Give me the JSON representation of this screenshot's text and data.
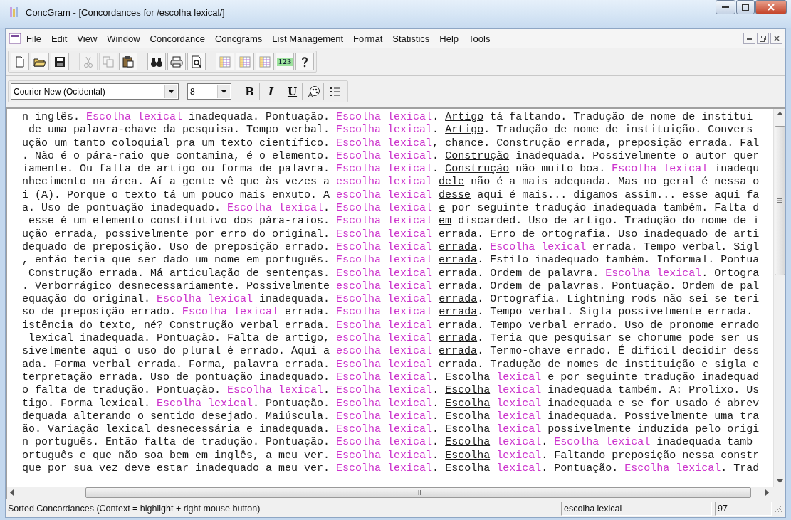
{
  "window": {
    "title": "ConcGram - [Concordances for /escolha lexical/]"
  },
  "menu": [
    {
      "label": "File"
    },
    {
      "label": "Edit"
    },
    {
      "label": "View"
    },
    {
      "label": "Window"
    },
    {
      "label": "Concordance"
    },
    {
      "label": "Concgrams"
    },
    {
      "label": "List Management"
    },
    {
      "label": "Format"
    },
    {
      "label": "Statistics"
    },
    {
      "label": "Help"
    },
    {
      "label": "Tools"
    }
  ],
  "toolbar": [
    {
      "kind": "new"
    },
    {
      "kind": "open"
    },
    {
      "kind": "save"
    },
    {
      "kind": "sep"
    },
    {
      "kind": "cut",
      "disabled": true
    },
    {
      "kind": "copy",
      "disabled": true
    },
    {
      "kind": "paste"
    },
    {
      "kind": "sep"
    },
    {
      "kind": "find"
    },
    {
      "kind": "print"
    },
    {
      "kind": "preview"
    },
    {
      "kind": "sep"
    },
    {
      "kind": "grid"
    },
    {
      "kind": "grid"
    },
    {
      "kind": "grid"
    },
    {
      "kind": "number",
      "label": "123"
    },
    {
      "kind": "help"
    }
  ],
  "format_bar": {
    "font": "Courier New (Ocidental)",
    "size": "8",
    "buttons": [
      {
        "kind": "bold",
        "label": "B"
      },
      {
        "kind": "italic",
        "label": "I"
      },
      {
        "kind": "underline",
        "label": "U"
      },
      {
        "kind": "color"
      },
      {
        "kind": "list"
      }
    ]
  },
  "concordance": {
    "lines": [
      {
        "segments": [
          {
            "kind": "text",
            "text": "n inglês. "
          },
          {
            "kind": "keyword",
            "text": "Escolha lexical"
          },
          {
            "kind": "text",
            "text": " inadequada. Pontuação. "
          },
          {
            "kind": "keyword",
            "text": "Escolha lexical"
          },
          {
            "kind": "text",
            "text": ". "
          },
          {
            "kind": "collocate",
            "text": "Artigo"
          },
          {
            "kind": "text",
            "text": " tá faltando. Tradução de nome de institui"
          }
        ]
      },
      {
        "segments": [
          {
            "kind": "text",
            "text": " de uma palavra-chave da pesquisa. Tempo verbal. "
          },
          {
            "kind": "keyword",
            "text": "Escolha lexical"
          },
          {
            "kind": "text",
            "text": ". "
          },
          {
            "kind": "collocate",
            "text": "Artigo"
          },
          {
            "kind": "text",
            "text": ". Tradução de nome de instituição. Convers"
          }
        ]
      },
      {
        "segments": [
          {
            "kind": "text",
            "text": "ução um tanto coloquial pra um texto científico. "
          },
          {
            "kind": "keyword",
            "text": "Escolha lexical"
          },
          {
            "kind": "text",
            "text": ", "
          },
          {
            "kind": "collocate",
            "text": "chance"
          },
          {
            "kind": "text",
            "text": ". Construção errada, preposição errada. Fal"
          }
        ]
      },
      {
        "segments": [
          {
            "kind": "text",
            "text": ". Não é o pára-raio que contamina, é o elemento. "
          },
          {
            "kind": "keyword",
            "text": "Escolha lexical"
          },
          {
            "kind": "text",
            "text": ". "
          },
          {
            "kind": "collocate",
            "text": "Construção"
          },
          {
            "kind": "text",
            "text": " inadequada. Possivelmente o autor quer"
          }
        ]
      },
      {
        "segments": [
          {
            "kind": "text",
            "text": "iamente. Ou falta de artigo ou forma de palavra. "
          },
          {
            "kind": "keyword",
            "text": "Escolha lexical"
          },
          {
            "kind": "text",
            "text": ". "
          },
          {
            "kind": "collocate",
            "text": "Construção"
          },
          {
            "kind": "text",
            "text": " não muito boa. "
          },
          {
            "kind": "keyword",
            "text": "Escolha lexical"
          },
          {
            "kind": "text",
            "text": " inadequ"
          }
        ]
      },
      {
        "segments": [
          {
            "kind": "text",
            "text": "nhecimento na área. Aí a gente vê que às vezes a "
          },
          {
            "kind": "keyword",
            "text": "escolha lexical "
          },
          {
            "kind": "collocate",
            "text": "dele"
          },
          {
            "kind": "text",
            "text": " não é a mais adequada. Mas no geral é nessa o"
          }
        ]
      },
      {
        "segments": [
          {
            "kind": "text",
            "text": "i (A). Porque o texto tá um pouco mais enxuto. A "
          },
          {
            "kind": "keyword",
            "text": "escolha lexical "
          },
          {
            "kind": "collocate",
            "text": "desse"
          },
          {
            "kind": "text",
            "text": " aqui é mais... digamos assim... esse aqui fa"
          }
        ]
      },
      {
        "segments": [
          {
            "kind": "text",
            "text": "a. Uso de pontuação inadequado. "
          },
          {
            "kind": "keyword",
            "text": "Escolha lexical"
          },
          {
            "kind": "text",
            "text": ". "
          },
          {
            "kind": "keyword",
            "text": "Escolha lexical "
          },
          {
            "kind": "collocate",
            "text": "e"
          },
          {
            "kind": "text",
            "text": " por seguinte tradução inadequada também. Falta d"
          }
        ]
      },
      {
        "segments": [
          {
            "kind": "text",
            "text": " esse é um elemento constitutivo dos pára-raios. "
          },
          {
            "kind": "keyword",
            "text": "Escolha lexical "
          },
          {
            "kind": "collocate",
            "text": "em"
          },
          {
            "kind": "text",
            "text": " discarded. Uso de artigo. Tradução do nome de i"
          }
        ]
      },
      {
        "segments": [
          {
            "kind": "text",
            "text": "ução errada, possivelmente por erro do original. "
          },
          {
            "kind": "keyword",
            "text": "Escolha lexical "
          },
          {
            "kind": "collocate",
            "text": "errada"
          },
          {
            "kind": "text",
            "text": ". Erro de ortografia. Uso inadequado de arti"
          }
        ]
      },
      {
        "segments": [
          {
            "kind": "text",
            "text": "dequado de preposição. Uso de preposição errado. "
          },
          {
            "kind": "keyword",
            "text": "Escolha lexical "
          },
          {
            "kind": "collocate",
            "text": "errada"
          },
          {
            "kind": "text",
            "text": ". "
          },
          {
            "kind": "keyword",
            "text": "Escolha lexical"
          },
          {
            "kind": "text",
            "text": " errada. Tempo verbal. Sigl"
          }
        ]
      },
      {
        "segments": [
          {
            "kind": "text",
            "text": ", então teria que ser dado um nome em português. "
          },
          {
            "kind": "keyword",
            "text": "Escolha lexical "
          },
          {
            "kind": "collocate",
            "text": "errada"
          },
          {
            "kind": "text",
            "text": ". Estilo inadequado também. Informal. Pontua"
          }
        ]
      },
      {
        "segments": [
          {
            "kind": "text",
            "text": " Construção errada. Má articulação de sentenças. "
          },
          {
            "kind": "keyword",
            "text": "Escolha lexical "
          },
          {
            "kind": "collocate",
            "text": "errada"
          },
          {
            "kind": "text",
            "text": ". Ordem de palavra. "
          },
          {
            "kind": "keyword",
            "text": "Escolha lexical"
          },
          {
            "kind": "text",
            "text": ". Ortogra"
          }
        ]
      },
      {
        "segments": [
          {
            "kind": "text",
            "text": ". Verborrágico desnecessariamente. Possivelmente "
          },
          {
            "kind": "keyword",
            "text": "escolha lexical "
          },
          {
            "kind": "collocate",
            "text": "errada"
          },
          {
            "kind": "text",
            "text": ". Ordem de palavras. Pontuação. Ordem de pal"
          }
        ]
      },
      {
        "segments": [
          {
            "kind": "text",
            "text": "equação do original. "
          },
          {
            "kind": "keyword",
            "text": "Escolha lexical"
          },
          {
            "kind": "text",
            "text": " inadequada. "
          },
          {
            "kind": "keyword",
            "text": "Escolha lexical "
          },
          {
            "kind": "collocate",
            "text": "errada"
          },
          {
            "kind": "text",
            "text": ". Ortografia. Lightning rods não sei se teri"
          }
        ]
      },
      {
        "segments": [
          {
            "kind": "text",
            "text": "so de preposição errado. "
          },
          {
            "kind": "keyword",
            "text": "Escolha lexical"
          },
          {
            "kind": "text",
            "text": " errada. "
          },
          {
            "kind": "keyword",
            "text": "Escolha lexical "
          },
          {
            "kind": "collocate",
            "text": "errada"
          },
          {
            "kind": "text",
            "text": ". Tempo verbal. Sigla possivelmente errada."
          }
        ]
      },
      {
        "segments": [
          {
            "kind": "text",
            "text": "istência do texto, né? Construção verbal errada. "
          },
          {
            "kind": "keyword",
            "text": "Escolha lexical "
          },
          {
            "kind": "collocate",
            "text": "errada"
          },
          {
            "kind": "text",
            "text": ". Tempo verbal errado. Uso de pronome errado"
          }
        ]
      },
      {
        "segments": [
          {
            "kind": "text",
            "text": " lexical inadequada. Pontuação. Falta de artigo, "
          },
          {
            "kind": "keyword",
            "text": "escolha lexical "
          },
          {
            "kind": "collocate",
            "text": "errada"
          },
          {
            "kind": "text",
            "text": ". Teria que pesquisar se chorume pode ser us"
          }
        ]
      },
      {
        "segments": [
          {
            "kind": "text",
            "text": "sivelmente aqui o uso do plural é errado. Aqui a "
          },
          {
            "kind": "keyword",
            "text": "escolha lexical "
          },
          {
            "kind": "collocate",
            "text": "errada"
          },
          {
            "kind": "text",
            "text": ". Termo-chave errado. É difícil decidir dess"
          }
        ]
      },
      {
        "segments": [
          {
            "kind": "text",
            "text": "ada. Forma verbal errada. Forma, palavra errada. "
          },
          {
            "kind": "keyword",
            "text": "Escolha lexical "
          },
          {
            "kind": "collocate",
            "text": "errada"
          },
          {
            "kind": "text",
            "text": ". Tradução de nomes de instituição e sigla e"
          }
        ]
      },
      {
        "segments": [
          {
            "kind": "text",
            "text": "terpretação errada. Uso de pontuação inadequado. "
          },
          {
            "kind": "keyword",
            "text": "Escolha lexical"
          },
          {
            "kind": "text",
            "text": ". "
          },
          {
            "kind": "collocate",
            "text": "Escolha"
          },
          {
            "kind": "keyword",
            "text": " lexical"
          },
          {
            "kind": "text",
            "text": " e por seguinte tradução inadequad"
          }
        ]
      },
      {
        "segments": [
          {
            "kind": "text",
            "text": "o falta de tradução. Pontuação. "
          },
          {
            "kind": "keyword",
            "text": "Escolha lexical"
          },
          {
            "kind": "text",
            "text": ". "
          },
          {
            "kind": "keyword",
            "text": "Escolha lexical"
          },
          {
            "kind": "text",
            "text": ". "
          },
          {
            "kind": "collocate",
            "text": "Escolha"
          },
          {
            "kind": "keyword",
            "text": " lexical"
          },
          {
            "kind": "text",
            "text": " inadequada também. A: Prolixo. Us"
          }
        ]
      },
      {
        "segments": [
          {
            "kind": "text",
            "text": "tigo. Forma lexical. "
          },
          {
            "kind": "keyword",
            "text": "Escolha lexical"
          },
          {
            "kind": "text",
            "text": ". Pontuação. "
          },
          {
            "kind": "keyword",
            "text": "Escolha lexical"
          },
          {
            "kind": "text",
            "text": ". "
          },
          {
            "kind": "collocate",
            "text": "Escolha"
          },
          {
            "kind": "keyword",
            "text": " lexical"
          },
          {
            "kind": "text",
            "text": " inadequada e se for usado é abrev"
          }
        ]
      },
      {
        "segments": [
          {
            "kind": "text",
            "text": "dequada alterando o sentido desejado. Maiúscula. "
          },
          {
            "kind": "keyword",
            "text": "Escolha lexical"
          },
          {
            "kind": "text",
            "text": ". "
          },
          {
            "kind": "collocate",
            "text": "Escolha"
          },
          {
            "kind": "keyword",
            "text": " lexical"
          },
          {
            "kind": "text",
            "text": " inadequada. Possivelmente uma tra"
          }
        ]
      },
      {
        "segments": [
          {
            "kind": "text",
            "text": "ão. Variação lexical desnecessária e inadequada. "
          },
          {
            "kind": "keyword",
            "text": "Escolha lexical"
          },
          {
            "kind": "text",
            "text": ". "
          },
          {
            "kind": "collocate",
            "text": "Escolha"
          },
          {
            "kind": "keyword",
            "text": " lexical"
          },
          {
            "kind": "text",
            "text": " possivelmente induzida pelo origi"
          }
        ]
      },
      {
        "segments": [
          {
            "kind": "text",
            "text": "n português. Então falta de tradução. Pontuação. "
          },
          {
            "kind": "keyword",
            "text": "Escolha lexical"
          },
          {
            "kind": "text",
            "text": ". "
          },
          {
            "kind": "collocate",
            "text": "Escolha"
          },
          {
            "kind": "keyword",
            "text": " lexical"
          },
          {
            "kind": "text",
            "text": ". "
          },
          {
            "kind": "keyword",
            "text": "Escolha lexical"
          },
          {
            "kind": "text",
            "text": " inadequada tamb"
          }
        ]
      },
      {
        "segments": [
          {
            "kind": "text",
            "text": "ortuguês e que não soa bem em inglês, a meu ver. "
          },
          {
            "kind": "keyword",
            "text": "Escolha lexical"
          },
          {
            "kind": "text",
            "text": ". "
          },
          {
            "kind": "collocate",
            "text": "Escolha"
          },
          {
            "kind": "keyword",
            "text": " lexical"
          },
          {
            "kind": "text",
            "text": ". Faltando preposição nessa constr"
          }
        ]
      },
      {
        "segments": [
          {
            "kind": "text",
            "text": "que por sua vez deve estar inadequado a meu ver. "
          },
          {
            "kind": "keyword",
            "text": "Escolha lexical"
          },
          {
            "kind": "text",
            "text": ". "
          },
          {
            "kind": "collocate",
            "text": "Escolha"
          },
          {
            "kind": "keyword",
            "text": " lexical"
          },
          {
            "kind": "text",
            "text": ". Pontuação. "
          },
          {
            "kind": "keyword",
            "text": "Escolha lexical"
          },
          {
            "kind": "text",
            "text": ". Trad"
          }
        ]
      }
    ]
  },
  "status_bar": {
    "message": "Sorted Concordances (Context = highlight + right mouse button)",
    "search_term": "escolha lexical",
    "count": "97"
  }
}
